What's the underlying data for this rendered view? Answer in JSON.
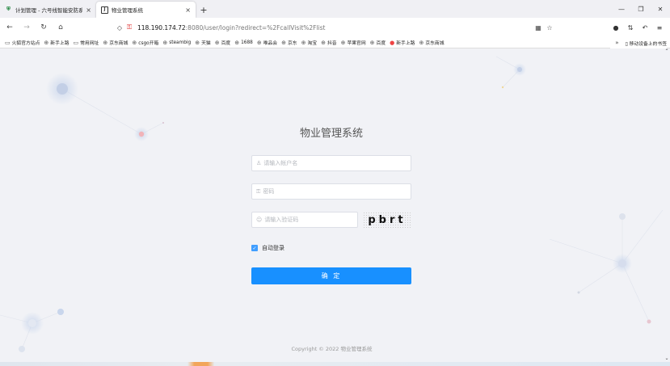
{
  "tabs": [
    {
      "title": "计划管理 - 六号线智能安防系统",
      "active": false
    },
    {
      "title": "物业管理系统",
      "active": true
    }
  ],
  "nav": {
    "url_host": "118.190.174.72",
    "url_path": ":8080/user/login?redirect=%2FcallVisit%2Flist"
  },
  "bookmarks": [
    {
      "label": "火狐官方站点",
      "icon": "folder-icon"
    },
    {
      "label": "新手上路",
      "icon": "globe-icon"
    },
    {
      "label": "常用网址",
      "icon": "folder-icon"
    },
    {
      "label": "京东商城",
      "icon": "globe-icon"
    },
    {
      "label": "csgo开箱",
      "icon": "globe-icon"
    },
    {
      "label": "steambig",
      "icon": "globe-icon"
    },
    {
      "label": "天猫",
      "icon": "globe-icon"
    },
    {
      "label": "百度",
      "icon": "globe-icon"
    },
    {
      "label": "1688",
      "icon": "globe-icon"
    },
    {
      "label": "唯品会",
      "icon": "globe-icon"
    },
    {
      "label": "京东",
      "icon": "globe-icon"
    },
    {
      "label": "淘宝",
      "icon": "globe-icon"
    },
    {
      "label": "抖音",
      "icon": "globe-icon"
    },
    {
      "label": "苹果官网",
      "icon": "globe-icon"
    },
    {
      "label": "百度",
      "icon": "globe-icon"
    },
    {
      "label": "新手上路",
      "icon": "firefox-icon"
    },
    {
      "label": "京东商城",
      "icon": "globe-icon"
    }
  ],
  "bookmarks_mobile": "移动设备上的书签",
  "login": {
    "system_name": "物业管理系统",
    "username_placeholder": "请输入帐户名",
    "password_placeholder": "密码",
    "captcha_placeholder": "请输入验证码",
    "captcha_text": "pbrt",
    "remember_label": "自动登录",
    "remember_checked": true,
    "submit_label": "确 定"
  },
  "footer": {
    "copyright": "Copyright © 2022 物业管理系统"
  },
  "colors": {
    "primary": "#1890ff",
    "background": "#f1f2f6"
  }
}
